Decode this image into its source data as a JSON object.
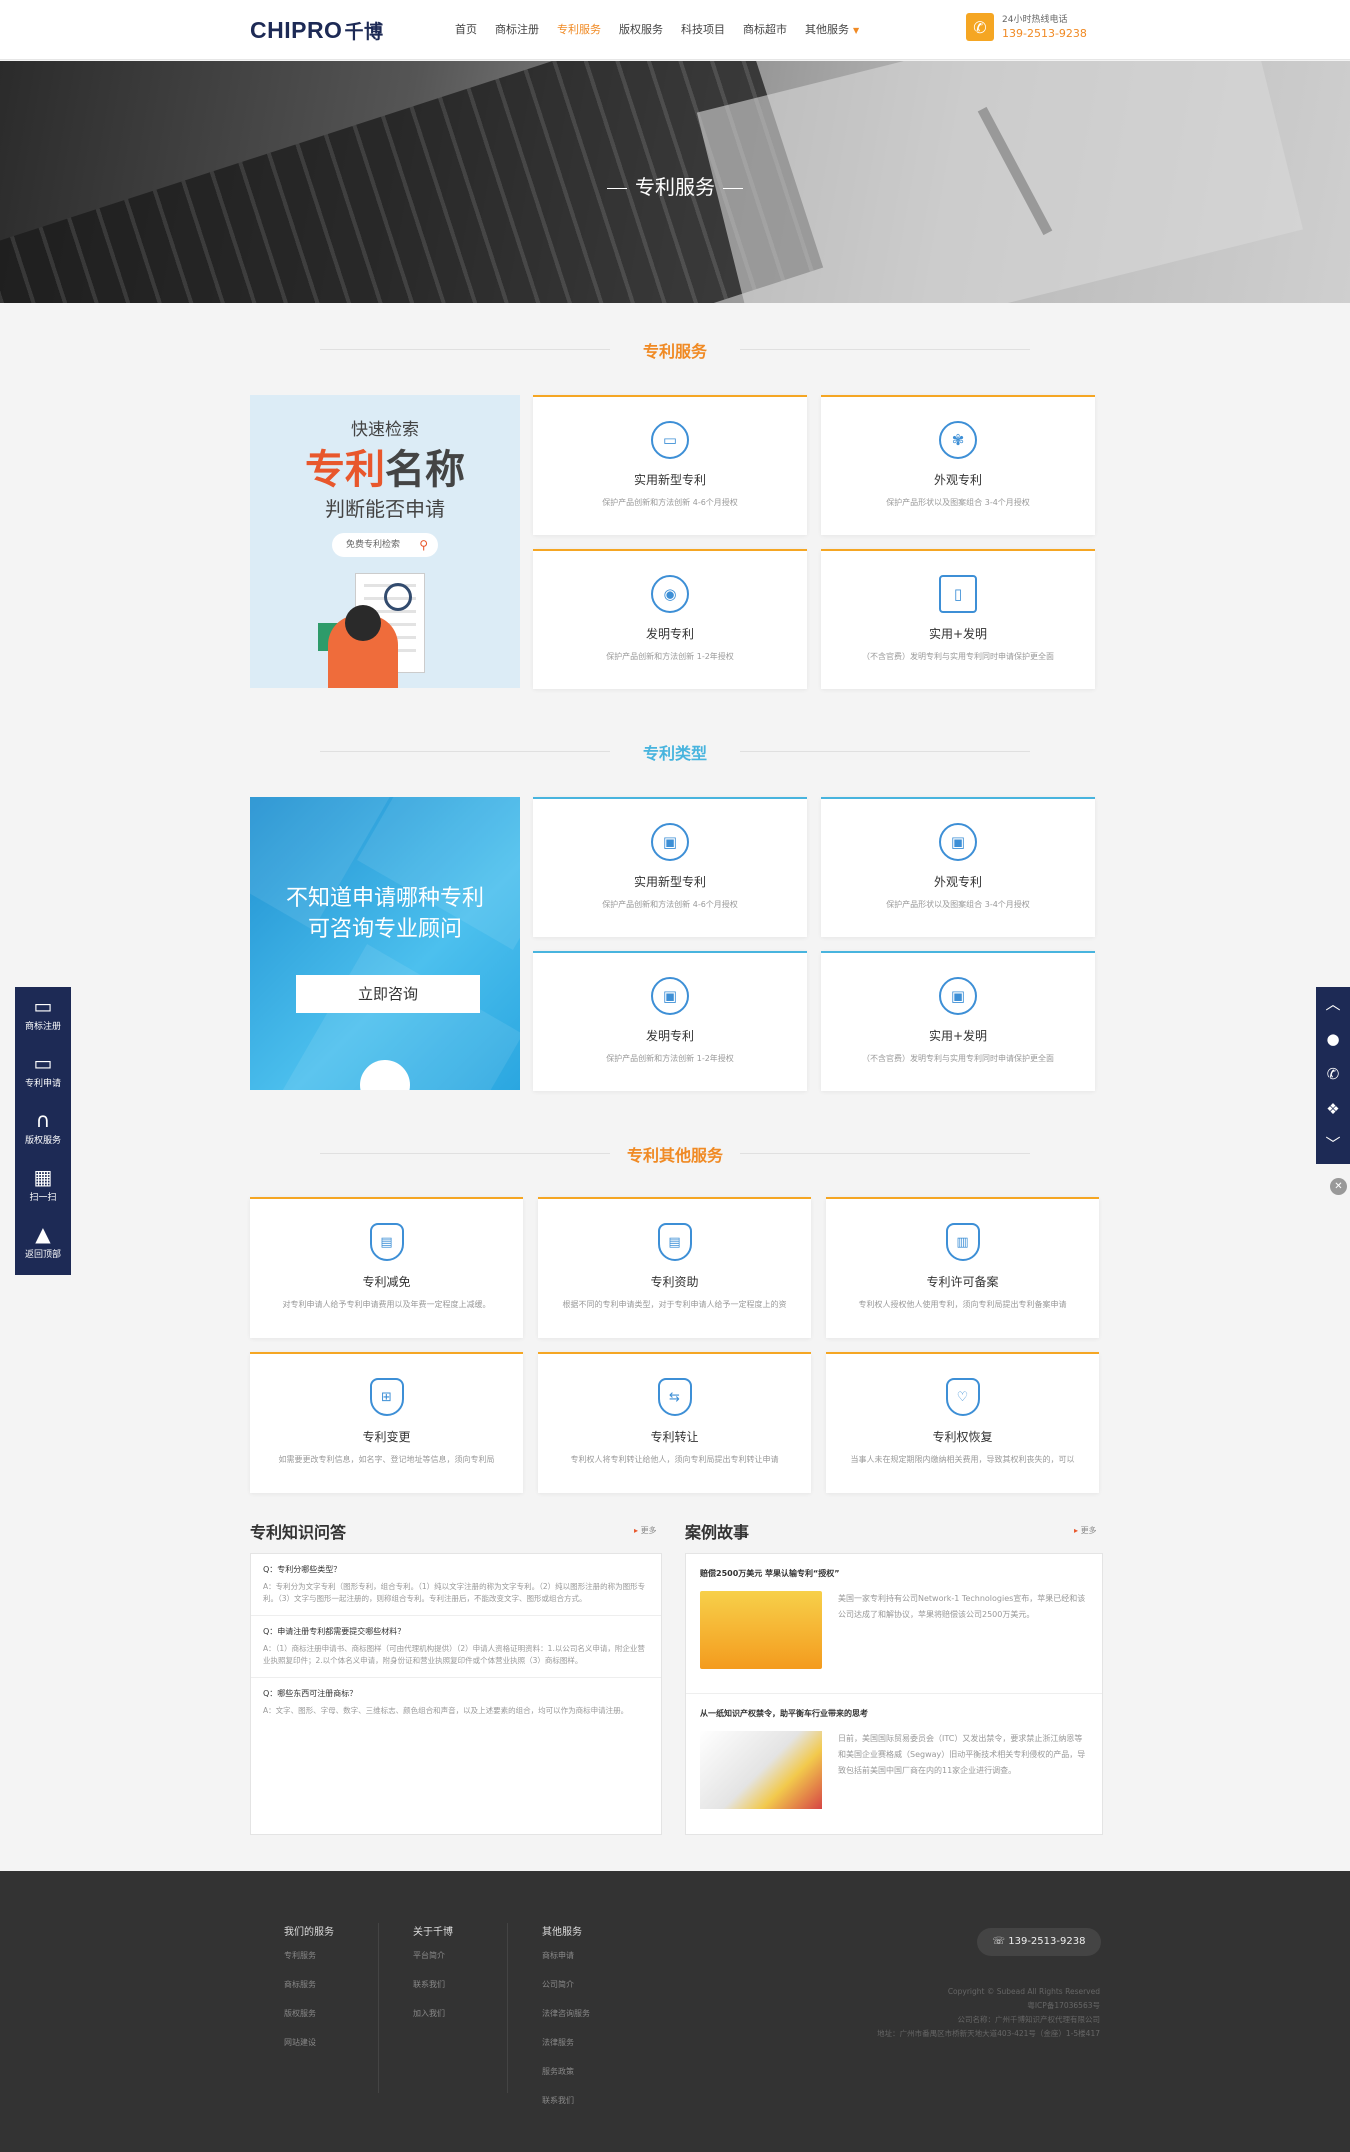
{
  "header": {
    "logo_main": "CHIPRO",
    "logo_cn": "千博",
    "nav": [
      {
        "label": "首页"
      },
      {
        "label": "商标注册"
      },
      {
        "label": "专利服务"
      },
      {
        "label": "版权服务"
      },
      {
        "label": "科技项目"
      },
      {
        "label": "商标超市"
      },
      {
        "label": "其他服务"
      }
    ],
    "hotline_label": "24小时热线电话",
    "hotline_number": "139-2513-9238",
    "accent": "#f08a24"
  },
  "banner": {
    "title": "专利服务"
  },
  "section1": {
    "title": "专利服务",
    "title_color": "#f08a24",
    "promo": {
      "line1": "快速检索",
      "line2a": "专利",
      "line2b": "名称",
      "line3": "判断能否申请",
      "search": "免费专利检索"
    },
    "cards": [
      {
        "title": "实用新型专利",
        "desc": "保护产品创新和方法创新 4-6个月授权",
        "icon": "▭"
      },
      {
        "title": "外观专利",
        "desc": "保护产品形状以及图案组合 3-4个月授权",
        "icon": "✾"
      },
      {
        "title": "发明专利",
        "desc": "保护产品创新和方法创新 1-2年授权",
        "icon": "◉"
      },
      {
        "title": "实用+发明",
        "desc": "（不含官费）发明专利与实用专利同时申请保护更全面",
        "icon": "▯"
      }
    ]
  },
  "section2": {
    "title": "专利类型",
    "title_color": "#48b4de",
    "promo": {
      "line1": "不知道申请哪种专利",
      "line2": "可咨询专业顾问",
      "button": "立即咨询"
    },
    "cards": [
      {
        "title": "实用新型专利",
        "desc": "保护产品创新和方法创新 4-6个月授权",
        "icon": "▣"
      },
      {
        "title": "外观专利",
        "desc": "保护产品形状以及图案组合 3-4个月授权",
        "icon": "▣"
      },
      {
        "title": "发明专利",
        "desc": "保护产品创新和方法创新 1-2年授权",
        "icon": "▣"
      },
      {
        "title": "实用+发明",
        "desc": "（不含官费）发明专利与实用专利同时申请保护更全面",
        "icon": "▣"
      }
    ]
  },
  "section3": {
    "title": "专利其他服务",
    "title_color": "#f08a24",
    "cards": [
      {
        "title": "专利减免",
        "desc": "对专利申请人给予专利申请费用以及年费一定程度上减缓。",
        "icon": "▤"
      },
      {
        "title": "专利资助",
        "desc": "根据不同的专利申请类型，对于专利申请人给予一定程度上的资",
        "icon": "▤"
      },
      {
        "title": "专利许可备案",
        "desc": "专利权人授权他人使用专利，须向专利局提出专利备案申请",
        "icon": "▥"
      },
      {
        "title": "专利变更",
        "desc": "如需要更改专利信息，如名字、登记地址等信息，须向专利局",
        "icon": "⊞"
      },
      {
        "title": "专利转让",
        "desc": "专利权人将专利转让给他人，须向专利局提出专利转让申请",
        "icon": "⇆"
      },
      {
        "title": "专利权恢复",
        "desc": "当事人未在规定期限内缴纳相关费用，导致其权利丧失的，可以",
        "icon": "♡"
      }
    ]
  },
  "qa": {
    "title": "专利知识问答",
    "more": "更多",
    "items": [
      {
        "q": "Q：专利分哪些类型？",
        "a": "A：专利分为文字专利（图形专利，组合专利。（1）纯以文字注册的称为文字专利。（2）纯以图形注册的称为图形专利。（3）文字与图形一起注册的，则称组合专利。专利注册后，不能改变文字、图形或组合方式。"
      },
      {
        "q": "Q：申请注册专利都需要提交哪些材料？",
        "a": "A：（1）商标注册申请书、商标图样（可由代理机构提供）（2）申请人资格证明资料：1.以公司名义申请，附企业营业执照复印件；2.以个体名义申请，附身份证和营业执照复印件或个体营业执照（3）商标图样。"
      },
      {
        "q": "Q：哪些东西可注册商标？",
        "a": "A：文字、图形、字母、数字、三维标志、颜色组合和声音，以及上述要素的组合，均可以作为商标申请注册。"
      }
    ]
  },
  "cases": {
    "title": "案例故事",
    "more": "更多",
    "items": [
      {
        "title": "赔偿2500万美元 苹果认输专利“授权”",
        "desc": "美国一家专利持有公司Network-1 Technologies宣布，苹果已经和该公司达成了和解协议，苹果将赔偿该公司2500万美元。"
      },
      {
        "title": "从一纸知识产权禁令，助平衡车行业带来的思考",
        "desc": "日前，美国国际贸易委员会（ITC）又发出禁令，要求禁止浙江纳恩等和美国企业赛格威（Segway）旧动平衡技术相关专利侵权的产品，导致包括前美国中国厂商在内的11家企业进行调查。"
      }
    ]
  },
  "leftbar": [
    {
      "label": "商标注册",
      "icon": "speech-bubble-icon"
    },
    {
      "label": "专利申请",
      "icon": "speech-bubble-icon"
    },
    {
      "label": "版权服务",
      "icon": "headset-icon"
    },
    {
      "label": "扫一扫",
      "icon": "qr-icon"
    },
    {
      "label": "返回顶部",
      "icon": "rocket-icon"
    }
  ],
  "footer": {
    "cols": [
      {
        "title": "我们的服务",
        "items": [
          "专利服务",
          "商标服务",
          "版权服务",
          "网站建设"
        ]
      },
      {
        "title": "关于千博",
        "items": [
          "平台简介",
          "联系我们",
          "加入我们"
        ]
      },
      {
        "title": "其他服务",
        "items": [
          "商标申请",
          "公司简介",
          "法律咨询服务",
          "法律服务",
          "服务政策",
          "联系我们"
        ]
      }
    ],
    "phone": "139-2513-9238",
    "copyright": "Copyright © Subead All Rights Reserved",
    "icp": "粤ICP备17036563号",
    "company": "公司名称：广州千博知识产权代理有限公司",
    "address": "地址：广州市番禺区市桥新天地大道403-421号（金座）1-5楼417"
  }
}
